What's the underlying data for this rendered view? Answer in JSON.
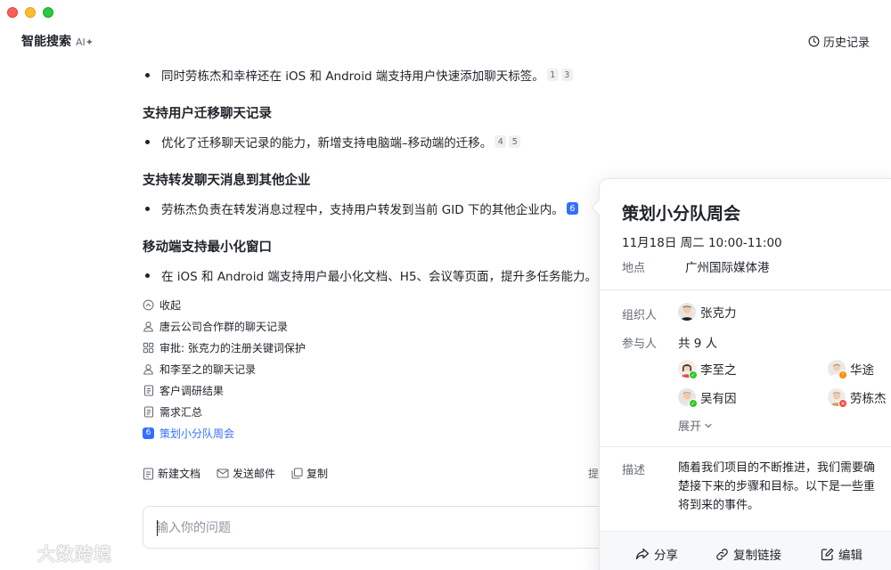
{
  "app": {
    "title": "智能搜索",
    "badge": "AI✦",
    "history_label": "历史记录"
  },
  "answer": {
    "items": [
      {
        "kind": "bullet",
        "text": "同时劳栋杰和幸梓还在 iOS 和 Android 端支持用户快速添加聊天标签。",
        "cites": [
          "1",
          "3"
        ]
      },
      {
        "kind": "heading",
        "text": "支持用户迁移聊天记录"
      },
      {
        "kind": "bullet",
        "text": "优化了迁移聊天记录的能力，新增支持电脑端–移动端的迁移。",
        "cites": [
          "4",
          "5"
        ]
      },
      {
        "kind": "heading",
        "text": "支持转发聊天消息到其他企业"
      },
      {
        "kind": "bullet",
        "text": "劳栋杰负责在转发消息过程中，支持用户转发到当前 GID 下的其他企业内。",
        "cites": [
          "6"
        ]
      },
      {
        "kind": "heading",
        "text": "移动端支持最小化窗口"
      },
      {
        "kind": "bullet",
        "text": "在 iOS 和 Android 端支持用户最小化文档、H5、会议等页面，提升多任务能力。",
        "cites": []
      }
    ]
  },
  "references": {
    "collapse_label": "收起",
    "items": [
      {
        "icon": "person-icon",
        "label": "唐云公司合作群的聊天记录"
      },
      {
        "icon": "grid-icon",
        "label": "审批: 张克力的注册关键词保护"
      },
      {
        "icon": "person-icon",
        "label": "和李至之的聊天记录"
      },
      {
        "icon": "document-icon",
        "label": "客户调研结果"
      },
      {
        "icon": "document-icon",
        "label": "需求汇总"
      },
      {
        "icon": "number-badge",
        "label": "策划小分队周会",
        "badge": "6",
        "active": true
      }
    ]
  },
  "actions": {
    "new_doc": "新建文档",
    "send_email": "发送邮件",
    "copy": "复制",
    "extra": "提"
  },
  "input": {
    "placeholder": "输入你的问题"
  },
  "watermark": {
    "text": "大数跨境"
  },
  "event": {
    "title": "策划小分队周会",
    "time": "11月18日 周二 10:00-11:00",
    "location_label": "地点",
    "location": "广州国际媒体港",
    "organizer_label": "组织人",
    "organizer": "张克力",
    "attendees_label": "参与人",
    "attendee_count": "共 9 人",
    "attendees": [
      {
        "name": "李至之",
        "status": "accepted"
      },
      {
        "name": "华途",
        "status": "tentative"
      },
      {
        "name": "吴有因",
        "status": "accepted"
      },
      {
        "name": "劳栋杰",
        "status": "declined"
      }
    ],
    "expand_label": "展开",
    "description_label": "描述",
    "description_lines": [
      "随着我们项目的不断推进，我们需要确",
      "楚接下来的步骤和目标。以下是一些重",
      "将到来的事件。"
    ],
    "footer": {
      "share": "分享",
      "copy_link": "复制链接",
      "edit": "编辑"
    }
  },
  "colors": {
    "accent": "#3370ff",
    "accepted": "#34c724",
    "tentative": "#ff8800",
    "declined": "#f54a45"
  }
}
